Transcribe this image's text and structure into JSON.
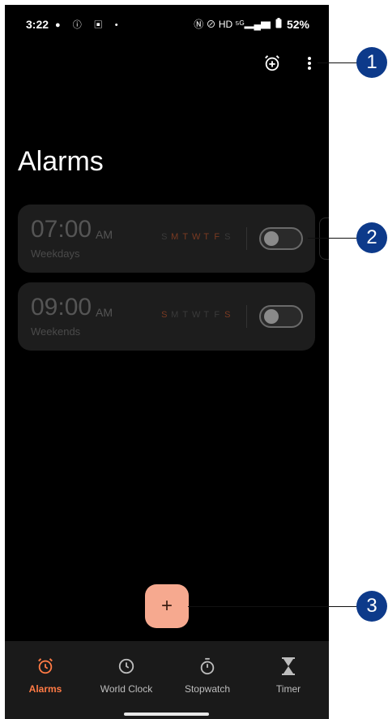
{
  "status_bar": {
    "time": "3:22",
    "left_icons": "● ⓘ ▣ •",
    "right_icons": "Ⓝ ⊘ HD ⁵ᴳ▂▄▆",
    "battery": "52%"
  },
  "header": {
    "title": "Alarms",
    "icons": [
      "add-alarm-icon",
      "more-options-icon"
    ]
  },
  "alarms": [
    {
      "time": "07:00",
      "ampm": "AM",
      "label": "Weekdays",
      "days": [
        {
          "d": "S",
          "active": false,
          "color": "#3a3a3a"
        },
        {
          "d": "M",
          "active": true,
          "color": "#7a3a22"
        },
        {
          "d": "T",
          "active": true,
          "color": "#7a3a22"
        },
        {
          "d": "W",
          "active": true,
          "color": "#7a3a22"
        },
        {
          "d": "T",
          "active": true,
          "color": "#7a3a22"
        },
        {
          "d": "F",
          "active": true,
          "color": "#7a3a22"
        },
        {
          "d": "S",
          "active": false,
          "color": "#3a3a3a"
        }
      ],
      "enabled": false
    },
    {
      "time": "09:00",
      "ampm": "AM",
      "label": "Weekends",
      "days": [
        {
          "d": "S",
          "active": true,
          "color": "#7a3a22"
        },
        {
          "d": "M",
          "active": false,
          "color": "#3a3a3a"
        },
        {
          "d": "T",
          "active": false,
          "color": "#3a3a3a"
        },
        {
          "d": "W",
          "active": false,
          "color": "#3a3a3a"
        },
        {
          "d": "T",
          "active": false,
          "color": "#3a3a3a"
        },
        {
          "d": "F",
          "active": false,
          "color": "#3a3a3a"
        },
        {
          "d": "S",
          "active": true,
          "color": "#7a3a22"
        }
      ],
      "enabled": false
    }
  ],
  "fab": {
    "label": "+"
  },
  "nav": {
    "items": [
      {
        "label": "Alarms",
        "icon": "alarm-icon",
        "active": true
      },
      {
        "label": "World Clock",
        "icon": "clock-icon",
        "active": false
      },
      {
        "label": "Stopwatch",
        "icon": "stopwatch-icon",
        "active": false
      },
      {
        "label": "Timer",
        "icon": "hourglass-icon",
        "active": false
      }
    ]
  },
  "callouts": [
    "1",
    "2",
    "3"
  ],
  "colors": {
    "accent": "#ff7a45",
    "fab": "#f6a98f",
    "callout": "#0d3a8a"
  }
}
